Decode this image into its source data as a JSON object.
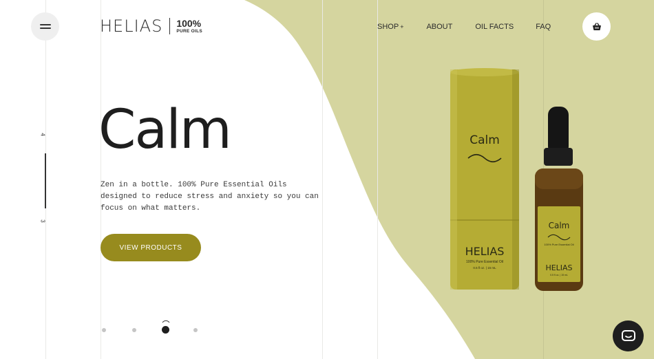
{
  "brand": {
    "name": "HELIAS",
    "tag_main": "100%",
    "tag_sub": "PURE OILS"
  },
  "nav": {
    "items": [
      {
        "label": "SHOP",
        "suffix": "+"
      },
      {
        "label": "ABOUT"
      },
      {
        "label": "OIL FACTS"
      },
      {
        "label": "FAQ"
      }
    ]
  },
  "slide_index": {
    "top": "4",
    "bottom": "3"
  },
  "hero": {
    "title": "Calm",
    "description": "Zen in a bottle. 100% Pure Essential Oils designed to reduce stress and anxiety so you can focus on what matters.",
    "cta_label": "VIEW PRODUCTS"
  },
  "product": {
    "tube_label": "Calm",
    "tube_brand": "HELIAS",
    "tube_sub": "100% Pure Essential Oil",
    "tube_volume": "0.5 fl oz. | 15 mL",
    "bottle_label": "Calm",
    "bottle_sub": "100% Pure Essential Oil",
    "bottle_brand": "HELIAS",
    "bottle_volume": "0.5 fl oz. | 15 mL"
  },
  "pagination": {
    "count": 4,
    "active_index": 2
  },
  "icons": {
    "menu": "hamburger-icon",
    "cart": "basket-icon",
    "chat": "chat-icon"
  },
  "colors": {
    "accent": "#978b1e",
    "background_shape": "#d5d59f",
    "tube": "#b5ac34",
    "dark": "#1e1e1e"
  }
}
